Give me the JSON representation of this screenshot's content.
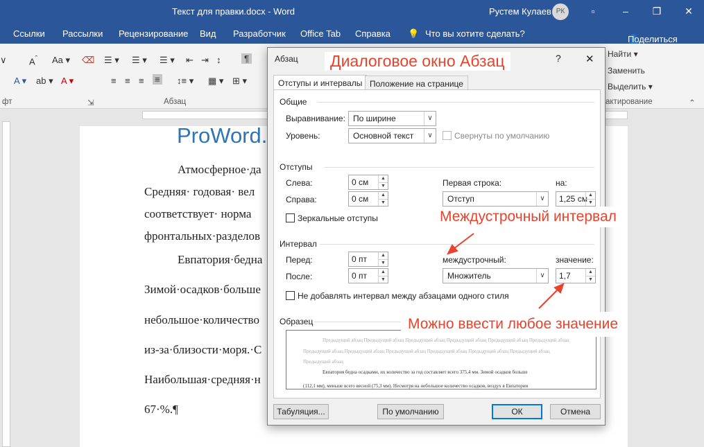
{
  "window": {
    "doc_title": "Текст для правки.docx  -  Word",
    "user_name": "Рустем Кулаев",
    "avatar_initials": "РК"
  },
  "ribbon_tabs": [
    "Ссылки",
    "Рассылки",
    "Рецензирование",
    "Вид",
    "Разработчик",
    "Office Tab",
    "Справка",
    "Что вы хотите сделать?",
    "Поделиться"
  ],
  "ribbon": {
    "find": "Найти",
    "replace": "Заменить",
    "select": "Выделить",
    "group_font": "фт",
    "group_paragraph": "Абзац",
    "group_editing": "актирование"
  },
  "document": {
    "heading": "ProWord.",
    "lines": [
      "Атмосферное·да",
      "Средняя· годовая· вел",
      "соответствует·  норма",
      "фронтальных·разделов",
      "Евпатория·бедна",
      "Зимой·осадков·больше",
      "небольшое·количество",
      "из-за·близости·моря.·С",
      "Наибольшая·средняя·н",
      "67·%.¶"
    ]
  },
  "dialog": {
    "title": "Абзац",
    "help": "?",
    "close": "✕",
    "tab1": "Отступы и интервалы",
    "tab2": "Положение на странице",
    "general": {
      "header": "Общие",
      "align_label": "Выравнивание:",
      "align_value": "По ширине",
      "level_label": "Уровень:",
      "level_value": "Основной текст",
      "collapsed_label": "Свернуты по умолчанию"
    },
    "indent": {
      "header": "Отступы",
      "left_label": "Слева:",
      "left_value": "0 см",
      "right_label": "Справа:",
      "right_value": "0 см",
      "first_line_label": "Первая строка:",
      "first_line_value": "Отступ",
      "by_label": "на:",
      "by_value": "1,25 см",
      "mirror_label": "Зеркальные отступы"
    },
    "spacing": {
      "header": "Интервал",
      "before_label": "Перед:",
      "before_value": "0 пт",
      "after_label": "После:",
      "after_value": "0 пт",
      "line_label": "междустрочный:",
      "line_value": "Множитель",
      "at_label": "значение:",
      "at_value": "1,7",
      "no_space_label": "Не добавлять интервал между абзацами одного стиля"
    },
    "sample": {
      "header": "Образец",
      "prev_line1": "Предыдущий абзац Предыдущий абзац Предыдущий абзац Предыдущий абзац Предыдущий абзац Предыдущий абзац",
      "prev_line2": "Предыдущий абзац Предыдущий абзац Предыдущий абзац Предыдущий абзац Предыдущий абзац Предыдущий абзац",
      "prev_line3": "Предыдущий абзац",
      "cur_line1": "Евпатория бедна осадками, их количество за год составляет всего 375,4 мм. Зимой осадков больше",
      "cur_line2": "(112,1 мм), меньше всего весной (75,3 мм). Несмотря на небольшое количество осадков, воздух в Евпатории"
    },
    "buttons": {
      "tabs": "Табуляция...",
      "default": "По умолчанию",
      "ok": "ОК",
      "cancel": "Отмена"
    }
  },
  "annotations": {
    "dialog_title": "Диалоговое окно Абзац",
    "line_spacing": "Междустрочный интервал",
    "any_value": "Можно ввести любое значение"
  },
  "colors": {
    "word_blue": "#2b579a",
    "heading_blue": "#2e75b6",
    "annotation_red": "#e8432d"
  }
}
